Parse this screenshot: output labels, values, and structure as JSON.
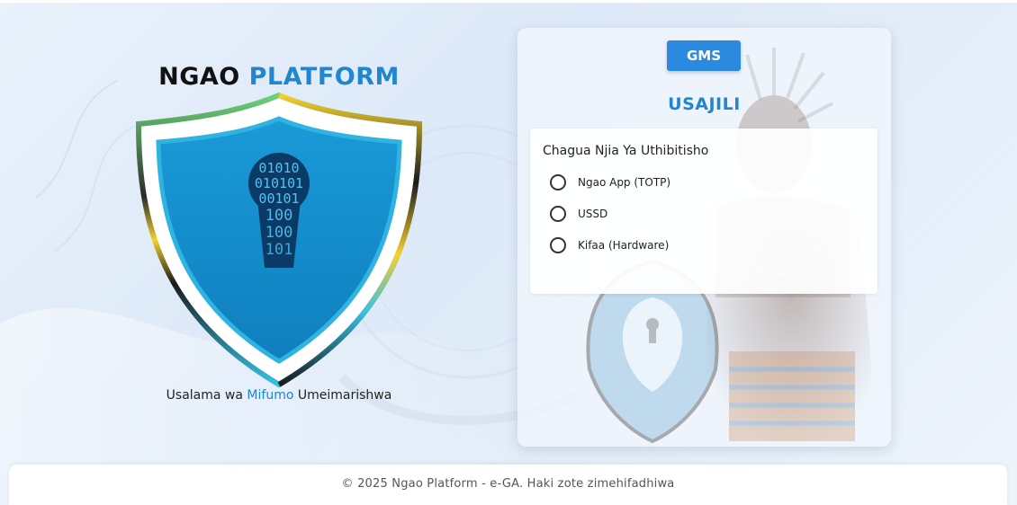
{
  "brand": {
    "title_part1": "NGAO",
    "title_part2": "PLATFORM",
    "tagline_part1": "Usalama wa ",
    "tagline_highlight": "Mifumo",
    "tagline_part2": " Umeimarishwa",
    "shield_binary": [
      "01010",
      "010101",
      "00101",
      "100",
      "100",
      "101"
    ]
  },
  "card": {
    "system_button": "GMS",
    "title": "USAJILI",
    "options_heading": "Chagua Njia Ya Uthibitisho",
    "options": [
      {
        "label": "Ngao App (TOTP)",
        "selected": false
      },
      {
        "label": "USSD",
        "selected": false
      },
      {
        "label": "Kifaa (Hardware)",
        "selected": false
      }
    ]
  },
  "footer": {
    "copyright": "© 2025 Ngao Platform - e-GA. Haki zote zimehifadhiwa"
  },
  "colors": {
    "accent": "#1f86cf",
    "button": "#2b8ae0",
    "shield_fill": "#1594d2"
  }
}
